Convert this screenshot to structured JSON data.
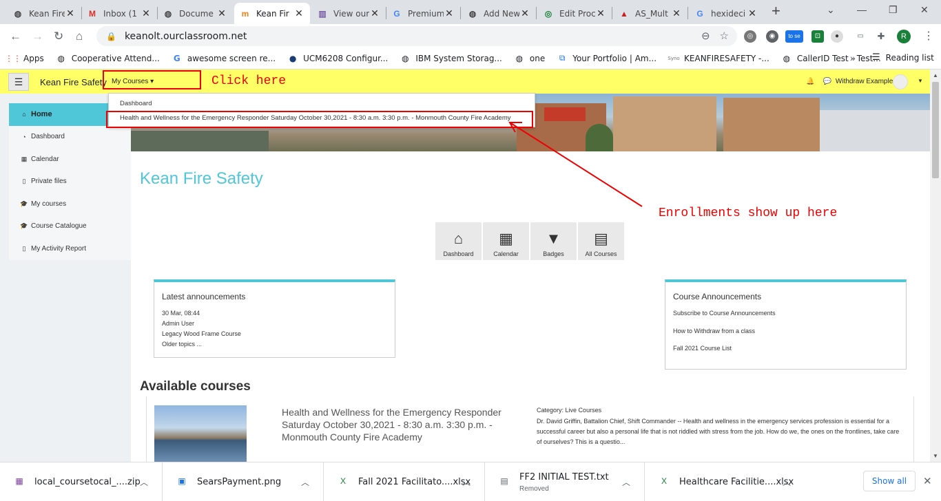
{
  "browser": {
    "tabs": [
      {
        "title": "Kean Fire",
        "icon": "globe-icon"
      },
      {
        "title": "Inbox (1",
        "icon": "gmail-icon"
      },
      {
        "title": "Docume",
        "icon": "globe-icon"
      },
      {
        "title": "Kean Fir",
        "icon": "moodle-icon"
      },
      {
        "title": "View our",
        "icon": "page-icon"
      },
      {
        "title": "Premium",
        "icon": "google-icon"
      },
      {
        "title": "Add New",
        "icon": "globe-icon"
      },
      {
        "title": "Edit Proc",
        "icon": "edit-icon"
      },
      {
        "title": "AS_Mult",
        "icon": "image-icon"
      },
      {
        "title": "hexideci",
        "icon": "google-icon"
      }
    ],
    "url": "keanolt.ourclassroom.net",
    "profile_initial": "R",
    "bookmarks": [
      {
        "label": "Apps"
      },
      {
        "label": "Cooperative Attend..."
      },
      {
        "label": "awesome screen re..."
      },
      {
        "label": "UCM6208 Configur..."
      },
      {
        "label": "IBM System Storag..."
      },
      {
        "label": "one"
      },
      {
        "label": "Your Portfolio | Am..."
      },
      {
        "label": "KEANFIRESAFETY -..."
      },
      {
        "label": "CallerID Test - Test..."
      }
    ],
    "reading_list": "Reading list",
    "ext_badge": "to se"
  },
  "site": {
    "brand": "Kean Fire Safety",
    "my_courses": "My Courses",
    "user_name": "Withdraw Example",
    "dropdown": {
      "items": [
        "Dashboard",
        "Health and Wellness for the Emergency Responder Saturday October 30,2021 - 8:30 a.m. 3:30 p.m. - Monmouth County Fire Academy"
      ]
    },
    "sidebar": [
      {
        "label": "Home",
        "icon": "home-icon"
      },
      {
        "label": "Dashboard",
        "icon": "dashboard-icon"
      },
      {
        "label": "Calendar",
        "icon": "calendar-icon"
      },
      {
        "label": "Private files",
        "icon": "file-icon"
      },
      {
        "label": "My courses",
        "icon": "graduation-cap-icon"
      },
      {
        "label": "Course Catalogue",
        "icon": "graduation-cap-icon"
      },
      {
        "label": "My Activity Report",
        "icon": "file-icon"
      }
    ],
    "title": "Kean Fire Safety",
    "quicklinks": [
      {
        "label": "Dashboard",
        "icon": "home-icon"
      },
      {
        "label": "Calendar",
        "icon": "calendar-icon"
      },
      {
        "label": "Badges",
        "icon": "bookmark-icon"
      },
      {
        "label": "All Courses",
        "icon": "book-icon"
      }
    ],
    "latest_announcements": {
      "title": "Latest announcements",
      "date": "30 Mar, 08:44",
      "author": "Admin User",
      "subject": "Legacy Wood Frame Course",
      "older": "Older topics ..."
    },
    "course_announcements": {
      "title": "Course Announcements",
      "links": [
        "Subscribe to Course Announcements",
        "How to Withdraw from a class",
        "Fall 2021 Course List"
      ]
    },
    "available_courses_title": "Available courses",
    "course": {
      "name": "Health and Wellness for the Emergency Responder Saturday October 30,2021 - 8:30 a.m. 3:30 p.m. - Monmouth County Fire Academy",
      "category_label": "Category:",
      "category": "Live Courses",
      "summary": "Dr. David Griffin, Battalion Chief, Shift Commander -- Health and wellness in the emergency services profession is essential for a successful career but also a personal life that is not riddled with stress from the job. How do we, the ones on the frontlines, take care of ourselves? This is a questio..."
    }
  },
  "annotations": {
    "click_here": "Click here",
    "enrollments": "Enrollments show up here",
    "color": "#ee0000"
  },
  "downloads": {
    "items": [
      {
        "name": "local_coursetocal_....zip",
        "sub": ""
      },
      {
        "name": "SearsPayment.png",
        "sub": ""
      },
      {
        "name": "Fall 2021 Facilitato....xlsx",
        "sub": ""
      },
      {
        "name": "FF2 INITIAL TEST.txt",
        "sub": "Removed"
      },
      {
        "name": "Healthcare Facilitie....xlsx",
        "sub": ""
      }
    ],
    "show_all": "Show all"
  }
}
